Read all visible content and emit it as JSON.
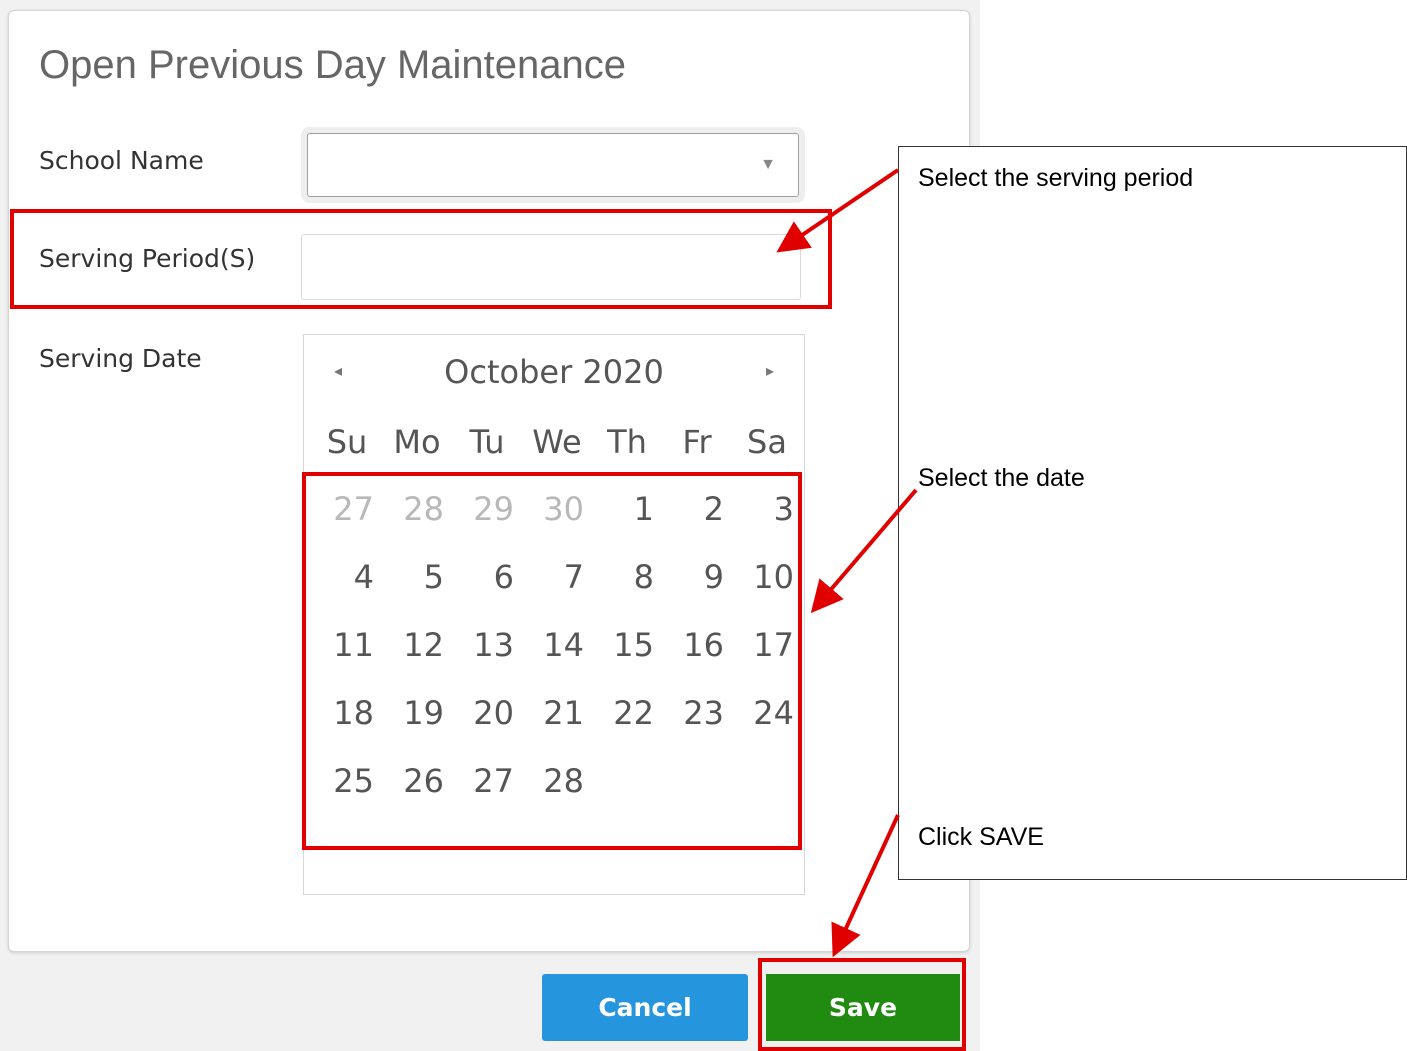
{
  "dialog": {
    "title": "Open Previous Day Maintenance",
    "school_name_label": "School Name",
    "serving_period_label": "Serving Period(S)",
    "serving_date_label": "Serving Date",
    "school_name_value": "",
    "serving_period_value": ""
  },
  "calendar": {
    "month_year": "October 2020",
    "prev_icon": "◂",
    "next_icon": "▸",
    "weekdays": [
      "Su",
      "Mo",
      "Tu",
      "We",
      "Th",
      "Fr",
      "Sa"
    ],
    "weeks": [
      [
        "27",
        "28",
        "29",
        "30",
        "1",
        "2",
        "3"
      ],
      [
        "4",
        "5",
        "6",
        "7",
        "8",
        "9",
        "10"
      ],
      [
        "11",
        "12",
        "13",
        "14",
        "15",
        "16",
        "17"
      ],
      [
        "18",
        "19",
        "20",
        "21",
        "22",
        "23",
        "24"
      ],
      [
        "25",
        "26",
        "27",
        "28",
        "",
        "",
        ""
      ]
    ]
  },
  "buttons": {
    "cancel": "Cancel",
    "save": "Save"
  },
  "annotations": {
    "select_period": "Select the serving period",
    "select_date": "Select the date",
    "click_save": "Click SAVE"
  },
  "colors": {
    "highlight": "#e00000",
    "cancel": "#2596dd",
    "save": "#218a10"
  }
}
